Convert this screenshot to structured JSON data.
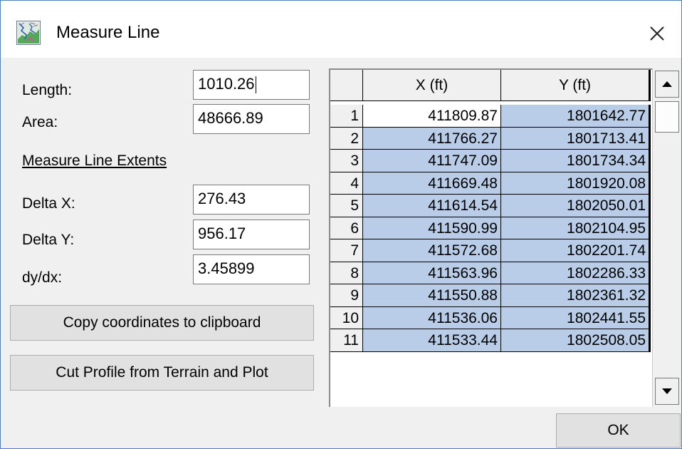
{
  "window": {
    "title": "Measure Line",
    "app_icon": "terrain-app-icon",
    "close_icon": "close-icon"
  },
  "form": {
    "length": {
      "label": "Length:",
      "value": "1010.26"
    },
    "area": {
      "label": "Area:",
      "value": "48666.89"
    },
    "extents_heading": "Measure Line Extents",
    "delta_x": {
      "label": "Delta X:",
      "value": "276.43"
    },
    "delta_y": {
      "label": "Delta Y:",
      "value": "956.17"
    },
    "dydx": {
      "label": "dy/dx:",
      "value": "3.45899"
    }
  },
  "buttons": {
    "copy": "Copy coordinates to clipboard",
    "cut_profile": "Cut Profile from Terrain and Plot",
    "ok": "OK"
  },
  "table": {
    "columns": [
      "X (ft)",
      "Y (ft)"
    ],
    "rows": [
      {
        "n": "1",
        "x": "411809.87",
        "y": "1801642.77"
      },
      {
        "n": "2",
        "x": "411766.27",
        "y": "1801713.41"
      },
      {
        "n": "3",
        "x": "411747.09",
        "y": "1801734.34"
      },
      {
        "n": "4",
        "x": "411669.48",
        "y": "1801920.08"
      },
      {
        "n": "5",
        "x": "411614.54",
        "y": "1802050.01"
      },
      {
        "n": "6",
        "x": "411590.99",
        "y": "1802104.95"
      },
      {
        "n": "7",
        "x": "411572.68",
        "y": "1802201.74"
      },
      {
        "n": "8",
        "x": "411563.96",
        "y": "1802286.33"
      },
      {
        "n": "9",
        "x": "411550.88",
        "y": "1802361.32"
      },
      {
        "n": "10",
        "x": "411536.06",
        "y": "1802441.55"
      },
      {
        "n": "11",
        "x": "411533.44",
        "y": "1802508.05"
      }
    ],
    "scroll_up_icon": "scroll-up-arrow-icon",
    "scroll_down_icon": "scroll-down-arrow-icon"
  },
  "colors": {
    "selection": "#b9cde8",
    "active_cell": "#ffffff",
    "window_border": "#4a7fbf"
  }
}
